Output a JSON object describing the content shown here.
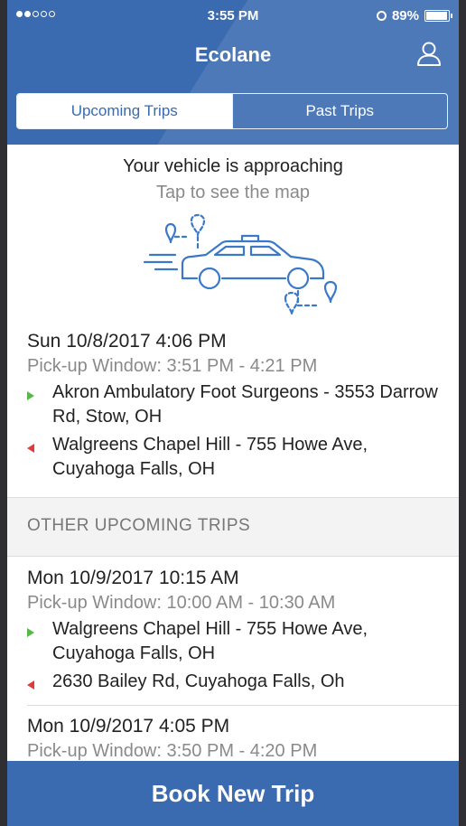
{
  "status_bar": {
    "time": "3:55 PM",
    "battery": "89%"
  },
  "header": {
    "title": "Ecolane",
    "profile_icon": "person-icon"
  },
  "tabs": [
    {
      "label": "Upcoming Trips",
      "active": true
    },
    {
      "label": "Past Trips",
      "active": false
    }
  ],
  "approach": {
    "title": "Your vehicle is approaching",
    "subtitle": "Tap to see the map",
    "illustration": "car-on-route-icon"
  },
  "current_trip": {
    "date": "Sun 10/8/2017 4:06 PM",
    "window": "Pick-up Window: 3:51 PM - 4:21 PM",
    "pickup": "Akron Ambulatory Foot Surgeons - 3553 Darrow Rd, Stow, OH",
    "dropoff": "Walgreens Chapel Hill - 755 Howe Ave, Cuyahoga Falls, OH"
  },
  "other_section": {
    "header": "OTHER UPCOMING TRIPS"
  },
  "other_trips": [
    {
      "date": "Mon 10/9/2017 10:15 AM",
      "window": "Pick-up Window: 10:00 AM - 10:30 AM",
      "pickup": "Walgreens Chapel Hill - 755 Howe Ave, Cuyahoga Falls, OH",
      "dropoff": "2630 Bailey Rd, Cuyahoga Falls, Oh"
    },
    {
      "date": "Mon 10/9/2017 4:05 PM",
      "window": "Pick-up Window: 3:50 PM - 4:20 PM"
    }
  ],
  "footer": {
    "book_label": "Book New Trip"
  },
  "colors": {
    "brand_blue": "#3a6ab0",
    "pickup_marker": "#57b848",
    "dropoff_marker": "#e23b3b"
  }
}
